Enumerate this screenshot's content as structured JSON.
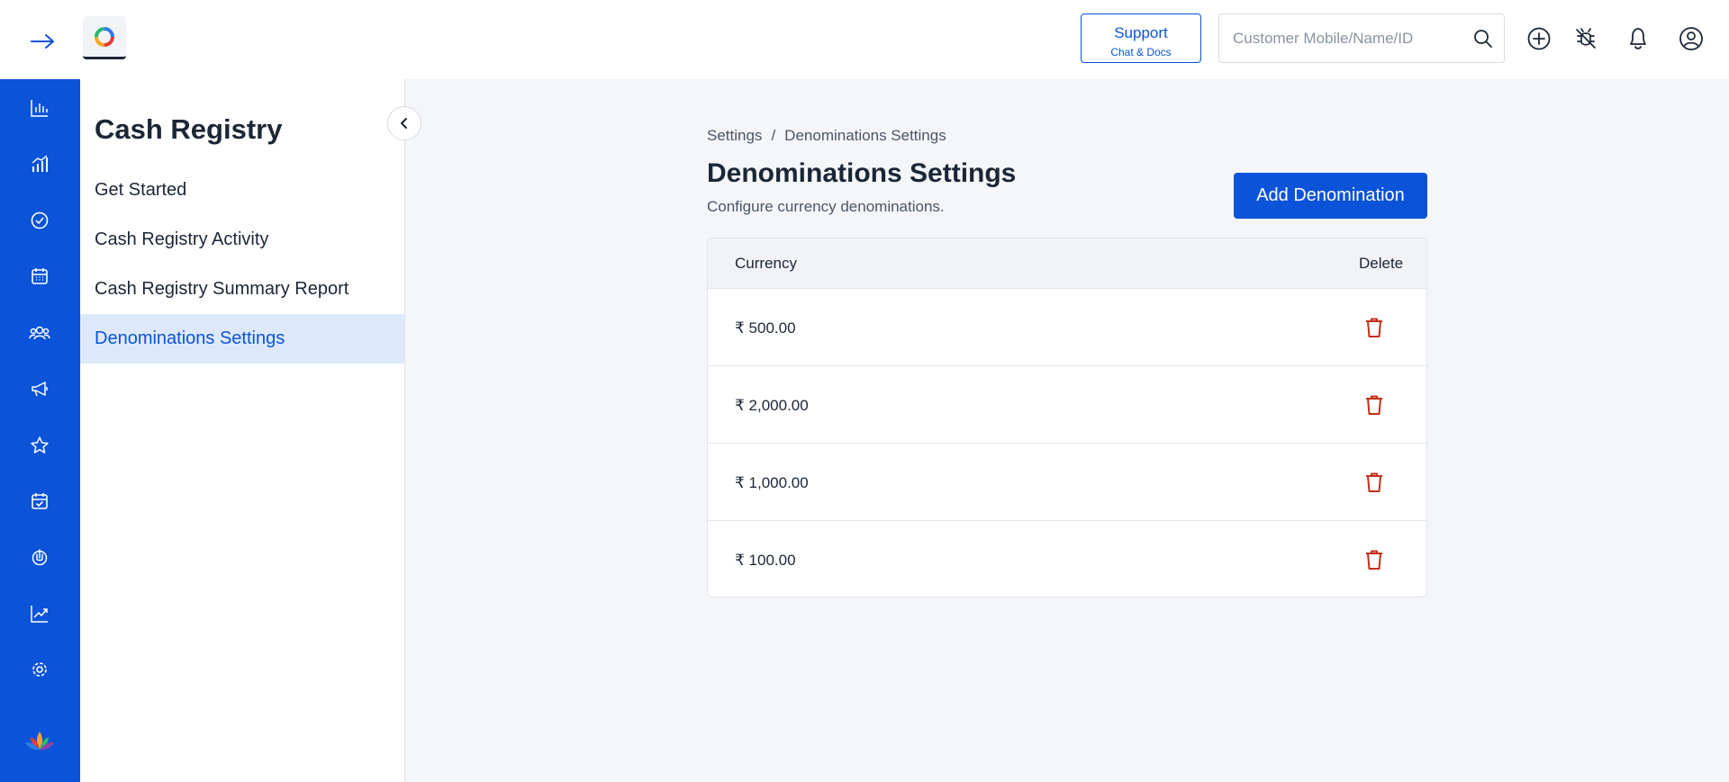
{
  "header": {
    "support_title": "Support",
    "support_sub": "Chat & Docs",
    "search_placeholder": "Customer Mobile/Name/ID"
  },
  "rail": {
    "items": [
      "bar-chart-icon",
      "analytics-icon",
      "check-circle-icon",
      "calendar-icon",
      "customers-icon",
      "megaphone-icon",
      "star-icon",
      "calendar-check-icon",
      "hand-icon",
      "trend-icon",
      "gear-icon"
    ],
    "accent": "#0b53d8"
  },
  "subnav": {
    "title": "Cash Registry",
    "items": [
      {
        "label": "Get Started"
      },
      {
        "label": "Cash Registry Activity"
      },
      {
        "label": "Cash Registry Summary Report"
      },
      {
        "label": "Denominations Settings",
        "active": true
      }
    ]
  },
  "main": {
    "breadcrumb": [
      "Settings",
      "Denominations Settings"
    ],
    "breadcrumb_sep": "/",
    "title": "Denominations Settings",
    "subtitle": "Configure currency denominations.",
    "add_button": "Add Denomination",
    "table": {
      "columns": [
        "Currency",
        "Delete"
      ],
      "rows": [
        "₹ 500.00",
        "₹ 2,000.00",
        "₹ 1,000.00",
        "₹ 100.00"
      ]
    },
    "delete_color": "#c0311a"
  }
}
